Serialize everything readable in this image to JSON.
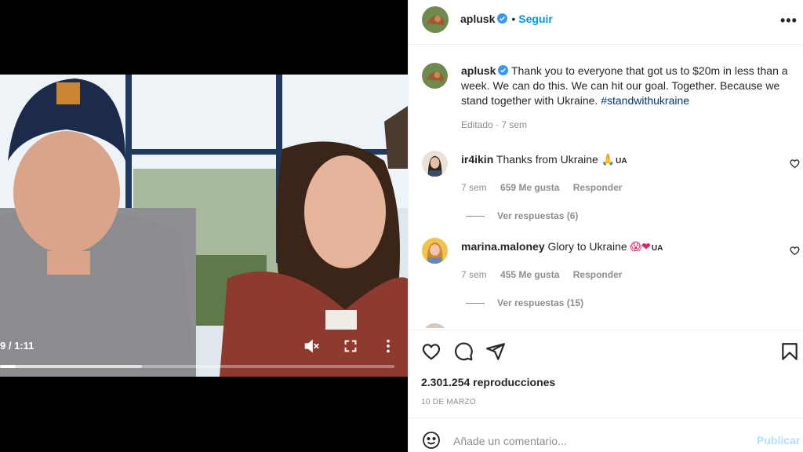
{
  "video": {
    "time_display": "9 / 1:11",
    "progress_played": 0.04,
    "progress_buffered": 0.36,
    "icons": [
      "mute-icon",
      "fullscreen-icon",
      "more-vertical-icon"
    ]
  },
  "post": {
    "author": "aplusk",
    "follow_label": "Seguir",
    "dot": "•",
    "more_label": "•••",
    "caption_text": "Thank you to everyone that got us to $20m in less than a week. We can do this. We can hit our goal. Together. Because we stand together with Ukraine.",
    "caption_hashtag": "#standwithukraine",
    "caption_meta": "Editado · 7 sem"
  },
  "comments": [
    {
      "username": "ir4ikin",
      "text": "Thanks from Ukraine",
      "emoji": "🙏",
      "flag": "UA",
      "time": "7 sem",
      "likes": "659 Me gusta",
      "reply_label": "Responder",
      "view_replies": "Ver respuestas (6)"
    },
    {
      "username": "marina.maloney",
      "text": "Glory to Ukraine",
      "emoji": "😱❤",
      "flag": "UA",
      "time": "7 sem",
      "likes": "455 Me gusta",
      "reply_label": "Responder",
      "view_replies": "Ver respuestas (15)"
    }
  ],
  "actions": {
    "views": "2.301.254 reproducciones",
    "date": "10 DE MARZO"
  },
  "add_comment": {
    "placeholder": "Añade un comentario...",
    "publish_label": "Publicar"
  },
  "colors": {
    "link_blue": "#0095f6",
    "hashtag": "#00376b",
    "muted": "#8e8e8e",
    "publish_disabled": "#b2dffc",
    "verified": "#3897f0"
  }
}
